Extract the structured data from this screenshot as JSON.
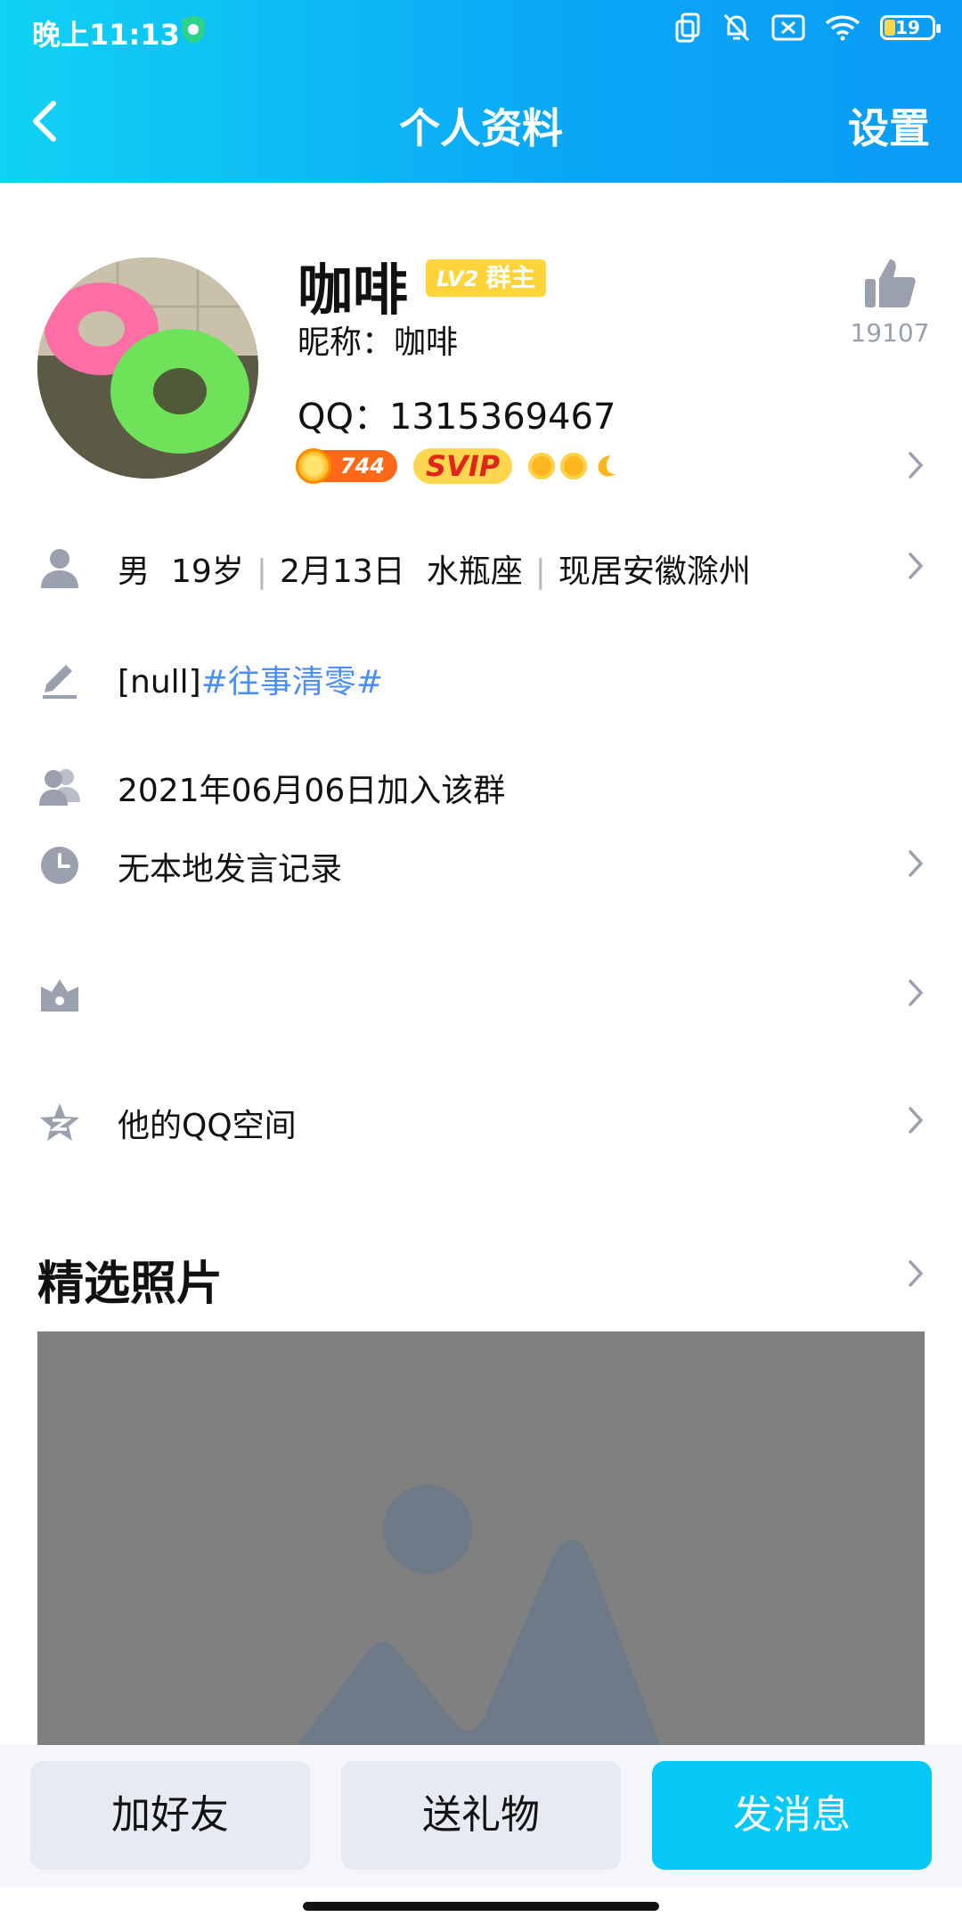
{
  "status": {
    "time": "晚上11:13",
    "battery": "19"
  },
  "nav": {
    "title": "个人资料",
    "settings": "设置"
  },
  "profile": {
    "name": "咖啡",
    "badge_level": "LV2",
    "badge_role": "群主",
    "nickname": "昵称：咖啡",
    "qq": "QQ：1315369467",
    "coin_count": "744",
    "svip": "SVIP",
    "like_count": "19107"
  },
  "info": {
    "gender": "男",
    "age": "19岁",
    "birthday": "2月13日",
    "zodiac": "水瓶座",
    "location": "现居安徽滁州",
    "signature_prefix": "[null]",
    "signature_tag": "#往事清零#",
    "join_date": "2021年06月06日加入该群",
    "speech_record": "无本地发言记录",
    "qzone": "他的QQ空间"
  },
  "photos": {
    "title": "精选照片"
  },
  "actions": {
    "add_friend": "加好友",
    "send_gift": "送礼物",
    "send_message": "发消息"
  }
}
